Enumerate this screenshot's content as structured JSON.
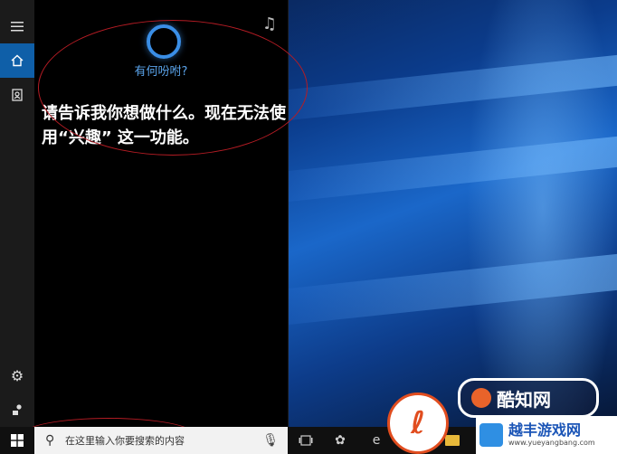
{
  "cortana": {
    "prompt": "有何吩咐?",
    "message": "请告诉我你想做什么。现在无法使用“兴趣” 这一功能。",
    "accent_color": "#3a8ee6"
  },
  "rail": {
    "items": [
      {
        "icon": "hamburger-menu-icon"
      },
      {
        "icon": "home-icon",
        "active": true
      },
      {
        "icon": "notebook-icon"
      },
      {
        "icon": "gear-icon"
      },
      {
        "icon": "feedback-icon"
      }
    ]
  },
  "search": {
    "placeholder": "在这里输入你要搜索的内容",
    "icon": "search-icon",
    "mic_icon": "microphone-icon"
  },
  "taskbar": {
    "icons": [
      "windows-start-icon",
      "task-view-icon",
      "app-icon",
      "edge-icon",
      "store-icon",
      "file-explorer-icon"
    ]
  },
  "watermark": {
    "badge_text": "酷知网",
    "site_name": "越丰游戏网",
    "site_url": "www.yueyangbang.com"
  }
}
